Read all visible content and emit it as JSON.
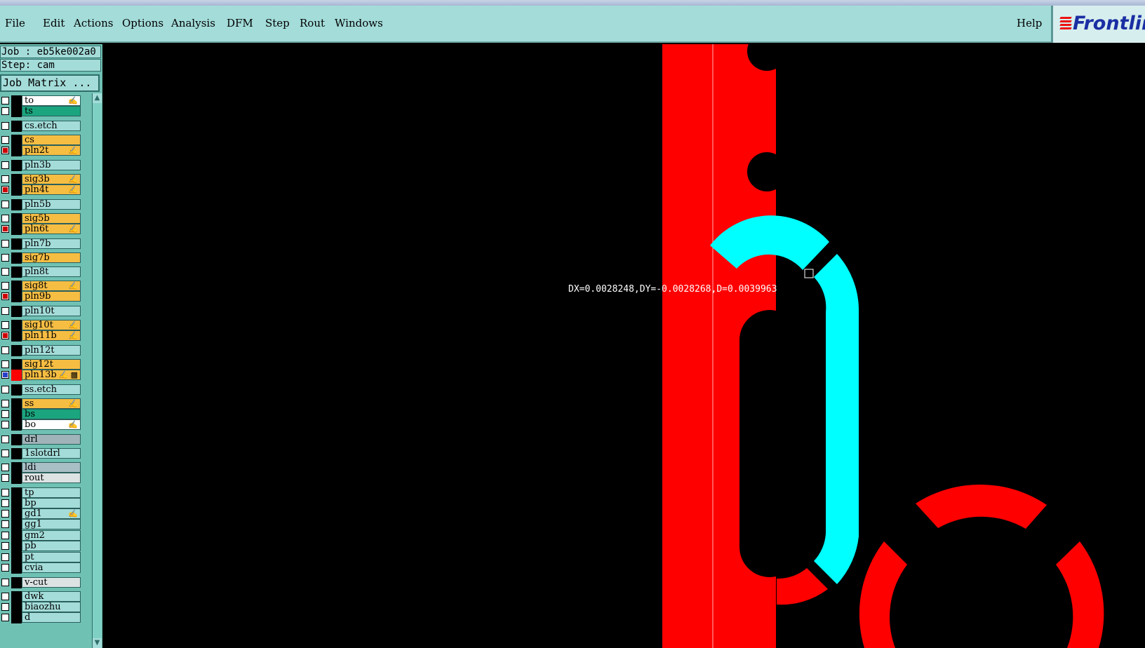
{
  "menu": [
    "File",
    "Edit",
    "Actions",
    "Options",
    "Analysis",
    "DFM",
    "Step",
    "Rout",
    "Windows",
    "Help"
  ],
  "logo": {
    "text": "Frontlin"
  },
  "job": {
    "job_label": "Job : eb5ke002a0",
    "step_label": "Step: cam",
    "matrix_button": "Job Matrix ..."
  },
  "layers": [
    {
      "name": "to",
      "color": "#ffffff",
      "mark": "✍",
      "checked": false
    },
    {
      "name": "ts",
      "color": "#1aa57e",
      "mark": "",
      "checked": false
    },
    {
      "name": "cs.etch",
      "color": "#a3dcd9",
      "mark": "",
      "checked": false
    },
    {
      "name": "cs",
      "color": "#f6bd43",
      "mark": "",
      "checked": false
    },
    {
      "name": "pln2t",
      "color": "#f6bd43",
      "mark": "✍",
      "checked": true
    },
    {
      "name": "pln3b",
      "color": "#a3dcd9",
      "mark": "",
      "checked": false
    },
    {
      "name": "sig3b",
      "color": "#f6bd43",
      "mark": "✍",
      "checked": false
    },
    {
      "name": "pln4t",
      "color": "#f6bd43",
      "mark": "✍",
      "checked": true
    },
    {
      "name": "pln5b",
      "color": "#a3dcd9",
      "mark": "",
      "checked": false
    },
    {
      "name": "sig5b",
      "color": "#f6bd43",
      "mark": "",
      "checked": false
    },
    {
      "name": "pln6t",
      "color": "#f6bd43",
      "mark": "✍",
      "checked": true
    },
    {
      "name": "pln7b",
      "color": "#a3dcd9",
      "mark": "",
      "checked": false
    },
    {
      "name": "sig7b",
      "color": "#f6bd43",
      "mark": "",
      "checked": false
    },
    {
      "name": "pln8t",
      "color": "#a3dcd9",
      "mark": "",
      "checked": false
    },
    {
      "name": "sig8t",
      "color": "#f6bd43",
      "mark": "✍",
      "checked": false
    },
    {
      "name": "pln9b",
      "color": "#f6bd43",
      "mark": "",
      "checked": true
    },
    {
      "name": "pln10t",
      "color": "#a3dcd9",
      "mark": "",
      "checked": false
    },
    {
      "name": "sig10t",
      "color": "#f6bd43",
      "mark": "✍",
      "checked": false
    },
    {
      "name": "pln11b",
      "color": "#f6bd43",
      "mark": "✍",
      "checked": true
    },
    {
      "name": "pln12t",
      "color": "#a3dcd9",
      "mark": "",
      "checked": false
    },
    {
      "name": "sig12t",
      "color": "#f6bd43",
      "mark": "",
      "checked": false
    },
    {
      "name": "pln13b",
      "color": "#f6bd43",
      "mark": "✍ ▩",
      "checked": "blue",
      "sidecolor": "red"
    },
    {
      "name": "ss.etch",
      "color": "#a3dcd9",
      "mark": "",
      "checked": false
    },
    {
      "name": "ss",
      "color": "#f6bd43",
      "mark": "✍",
      "checked": false
    },
    {
      "name": "bs",
      "color": "#1aa57e",
      "mark": "",
      "checked": false
    },
    {
      "name": "bo",
      "color": "#ffffff",
      "mark": "✍",
      "checked": false
    },
    {
      "name": "drl",
      "color": "#9fb3b8",
      "mark": "",
      "checked": false
    },
    {
      "name": "1slotdrl",
      "color": "#a3dcd9",
      "mark": "",
      "checked": false
    },
    {
      "name": "ldi",
      "color": "#a9bfc6",
      "mark": "",
      "checked": false
    },
    {
      "name": "rout",
      "color": "#dde3e3",
      "mark": "",
      "checked": false
    },
    {
      "name": "tp",
      "color": "#a3dcd9",
      "mark": "",
      "checked": false
    },
    {
      "name": "bp",
      "color": "#a3dcd9",
      "mark": "",
      "checked": false
    },
    {
      "name": "gd1",
      "color": "#a3dcd9",
      "mark": "✍",
      "checked": false
    },
    {
      "name": "gg1",
      "color": "#a3dcd9",
      "mark": "",
      "checked": false
    },
    {
      "name": "gm2",
      "color": "#a3dcd9",
      "mark": "",
      "checked": false
    },
    {
      "name": "pb",
      "color": "#a3dcd9",
      "mark": "",
      "checked": false
    },
    {
      "name": "pt",
      "color": "#a3dcd9",
      "mark": "",
      "checked": false
    },
    {
      "name": "cvia",
      "color": "#a3dcd9",
      "mark": "",
      "checked": false
    },
    {
      "name": "v-cut",
      "color": "#dde3e3",
      "mark": "",
      "checked": false
    },
    {
      "name": "dwk",
      "color": "#a3dcd9",
      "mark": "",
      "checked": false
    },
    {
      "name": "biaozhu",
      "color": "#a3dcd9",
      "mark": "",
      "checked": false
    },
    {
      "name": "d",
      "color": "#a3dcd9",
      "mark": "",
      "checked": false
    }
  ],
  "measure": {
    "dx": "DX=0.0028248,",
    "dy": "DY=-0.0028268,",
    "d": "D=0.0039963"
  },
  "colors": {
    "copper": "#ff0000",
    "highlight": "#00ffff",
    "background": "#000000"
  }
}
